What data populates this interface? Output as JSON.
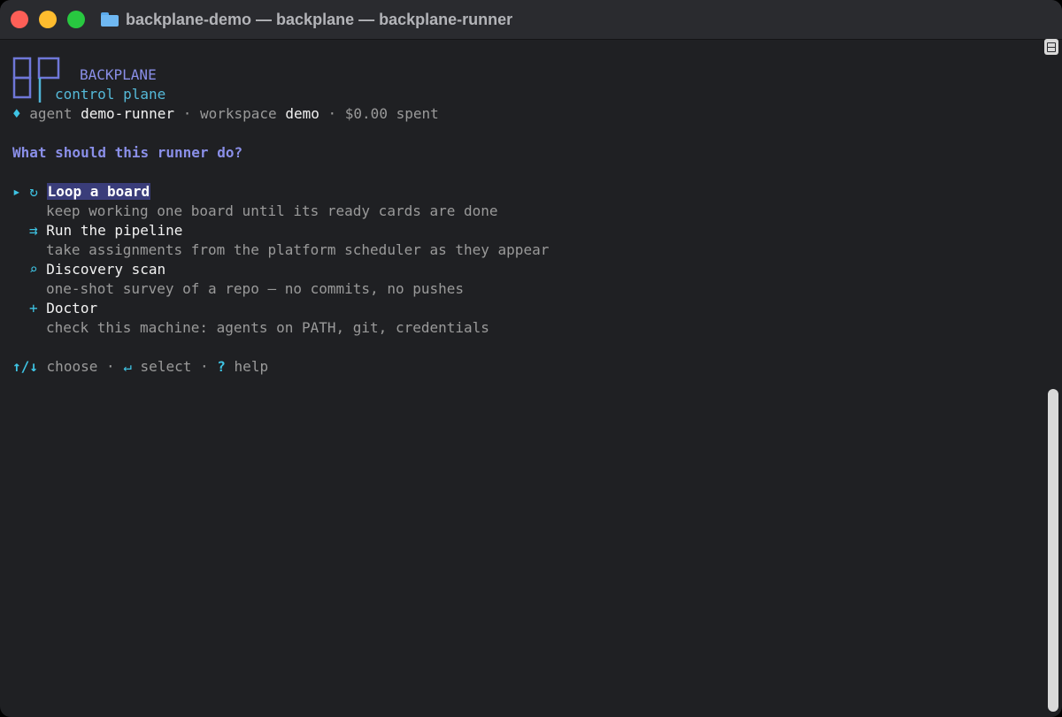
{
  "window": {
    "title": "backplane-demo — backplane — backplane-runner"
  },
  "brand": {
    "name": "BACKPLANE",
    "subtitle": "control plane"
  },
  "status": {
    "marker": "♦",
    "agent_label": "agent",
    "agent_value": "demo-runner",
    "sep": "·",
    "workspace_label": "workspace",
    "workspace_value": "demo",
    "spent": "$0.00 spent"
  },
  "prompt": {
    "question": "What should this runner do?"
  },
  "menu": {
    "cursor": "▸",
    "items": [
      {
        "icon": "↻",
        "label": "Loop a board",
        "desc": "keep working one board until its ready cards are done",
        "selected": true
      },
      {
        "icon": "⇉",
        "label": "Run the pipeline",
        "desc": "take assignments from the platform scheduler as they appear",
        "selected": false
      },
      {
        "icon": "⌕",
        "label": "Discovery scan",
        "desc": "one-shot survey of a repo — no commits, no pushes",
        "selected": false
      },
      {
        "icon": "+",
        "label": "Doctor",
        "desc": "check this machine: agents on PATH, git, credentials",
        "selected": false
      }
    ]
  },
  "footer": {
    "nav_key": "↑/↓",
    "nav_label": "choose",
    "sep": "·",
    "select_key": "↵",
    "select_label": "select",
    "help_key": "?",
    "help_label": "help"
  },
  "colors": {
    "background": "#1f2023",
    "accent_purple": "#8a8fe8",
    "accent_cyan": "#3ec4e4",
    "selection_bg": "#3a3d7a"
  }
}
